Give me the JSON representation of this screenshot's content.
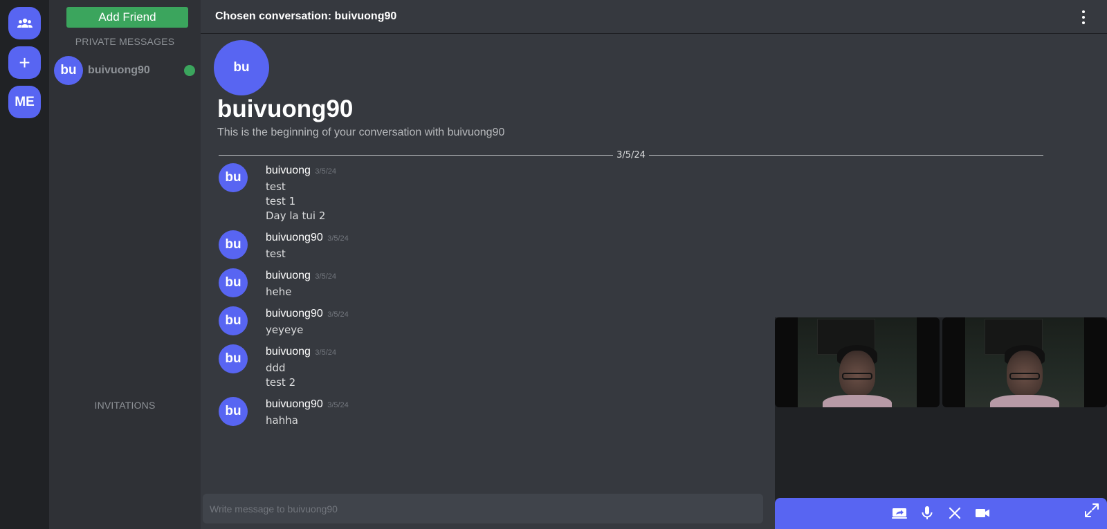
{
  "rail": {
    "items": [
      {
        "icon": "people-icon"
      },
      {
        "icon": "plus-icon",
        "label": "+"
      },
      {
        "label": "ME"
      }
    ]
  },
  "sidebar": {
    "add_friend_label": "Add Friend",
    "private_messages_title": "PRIVATE MESSAGES",
    "invitations_title": "INVITATIONS",
    "dms": [
      {
        "avatar_text": "bu",
        "name": "buivuong90",
        "status": "online",
        "status_color": "#3ba55d"
      }
    ]
  },
  "header": {
    "title": "Chosen conversation: buivuong90",
    "menu_icon": "kebab-menu-icon"
  },
  "intro": {
    "avatar_text": "bu",
    "name": "buivuong90",
    "subtitle": "This is the beginning of your conversation with buivuong90"
  },
  "date_divider": "3/5/24",
  "messages": [
    {
      "avatar_text": "bu",
      "author": "buivuong",
      "date": "3/5/24",
      "lines": [
        "test",
        "test 1",
        "Day la tui 2"
      ]
    },
    {
      "avatar_text": "bu",
      "author": "buivuong90",
      "date": "3/5/24",
      "lines": [
        "test"
      ]
    },
    {
      "avatar_text": "bu",
      "author": "buivuong",
      "date": "3/5/24",
      "lines": [
        "hehe"
      ]
    },
    {
      "avatar_text": "bu",
      "author": "buivuong90",
      "date": "3/5/24",
      "lines": [
        "yeyeye"
      ]
    },
    {
      "avatar_text": "bu",
      "author": "buivuong",
      "date": "3/5/24",
      "lines": [
        "ddd",
        "test 2"
      ]
    },
    {
      "avatar_text": "bu",
      "author": "buivuong90",
      "date": "3/5/24",
      "lines": [
        "hahha"
      ]
    }
  ],
  "composer": {
    "placeholder": "Write message to buivuong90"
  },
  "call": {
    "controls": [
      "screen-share-icon",
      "microphone-icon",
      "close-icon",
      "camera-icon"
    ],
    "expand_icon": "expand-icon"
  },
  "colors": {
    "accent": "#5865f2",
    "success": "#3ba55d",
    "background": "#36393f",
    "sidebar": "#2f3136",
    "rail": "#202225"
  }
}
